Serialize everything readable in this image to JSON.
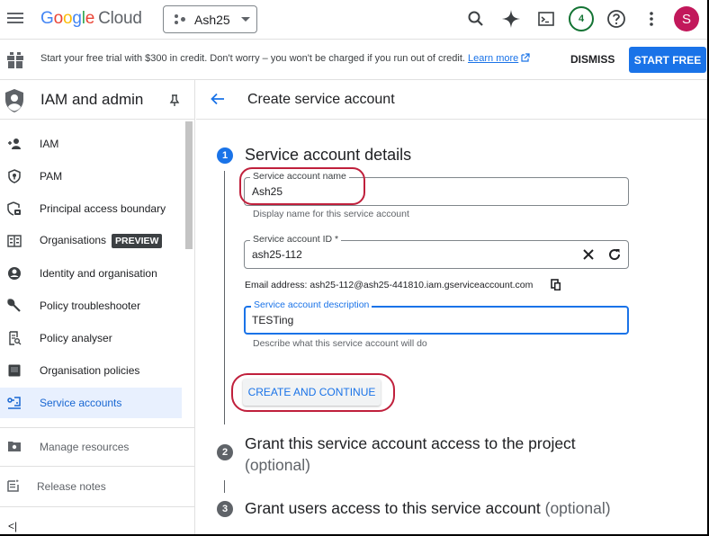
{
  "topbar": {
    "logo": {
      "g": "G",
      "o1": "o",
      "o2": "o",
      "g2": "g",
      "l": "l",
      "e": "e",
      "cloud": "Cloud"
    },
    "project": "Ash25",
    "notification_count": "4",
    "avatar_initial": "S",
    "icons": [
      "search-icon",
      "gemini-sparkle-icon",
      "cloud-shell-icon",
      "notifications-badge",
      "help-icon",
      "more-vert-icon",
      "account-avatar"
    ]
  },
  "banner": {
    "text": "Start your free trial with $300 in credit. Don't worry – you won't be charged if you run out of credit.",
    "learn_more": "Learn more",
    "dismiss": "DISMISS",
    "start_free": "START FREE"
  },
  "sidebar": {
    "title": "IAM and admin",
    "items": [
      {
        "label": "IAM",
        "icon": "person-add-icon"
      },
      {
        "label": "PAM",
        "icon": "shield-icon"
      },
      {
        "label": "Principal access boundary",
        "icon": "boundary-icon"
      },
      {
        "label": "Organisations",
        "icon": "organisation-icon",
        "badge": "PREVIEW"
      },
      {
        "label": "Identity and organisation",
        "icon": "account-circle-icon"
      },
      {
        "label": "Policy troubleshooter",
        "icon": "wrench-icon"
      },
      {
        "label": "Policy analyser",
        "icon": "policy-analyser-icon"
      },
      {
        "label": "Organisation policies",
        "icon": "policy-icon"
      },
      {
        "label": "Service accounts",
        "icon": "service-account-icon",
        "active": true
      }
    ],
    "manage_resources": "Manage resources",
    "release_notes": "Release notes",
    "collapse": "<|"
  },
  "main": {
    "title": "Create service account",
    "steps": [
      {
        "number": "1",
        "title": "Service account details"
      },
      {
        "number": "2",
        "title": "Grant this service account access to the project",
        "optional": "(optional)"
      },
      {
        "number": "3",
        "title": "Grant users access to this service account",
        "optional": "(optional)"
      }
    ],
    "form": {
      "name_label": "Service account name",
      "name_value": "Ash25",
      "name_hint": "Display name for this service account",
      "id_label": "Service account ID *",
      "id_value": "ash25-112",
      "email": "Email address: ash25-112@ash25-441810.iam.gserviceaccount.com",
      "desc_label": "Service account description",
      "desc_value": "TESTing",
      "desc_hint": "Describe what this service account will do",
      "create_button": "CREATE AND CONTINUE"
    }
  },
  "colors": {
    "primary": "#1a73e8",
    "highlight": "#c0203c",
    "active_bg": "#e8f0fe",
    "avatar": "#c2185b"
  }
}
